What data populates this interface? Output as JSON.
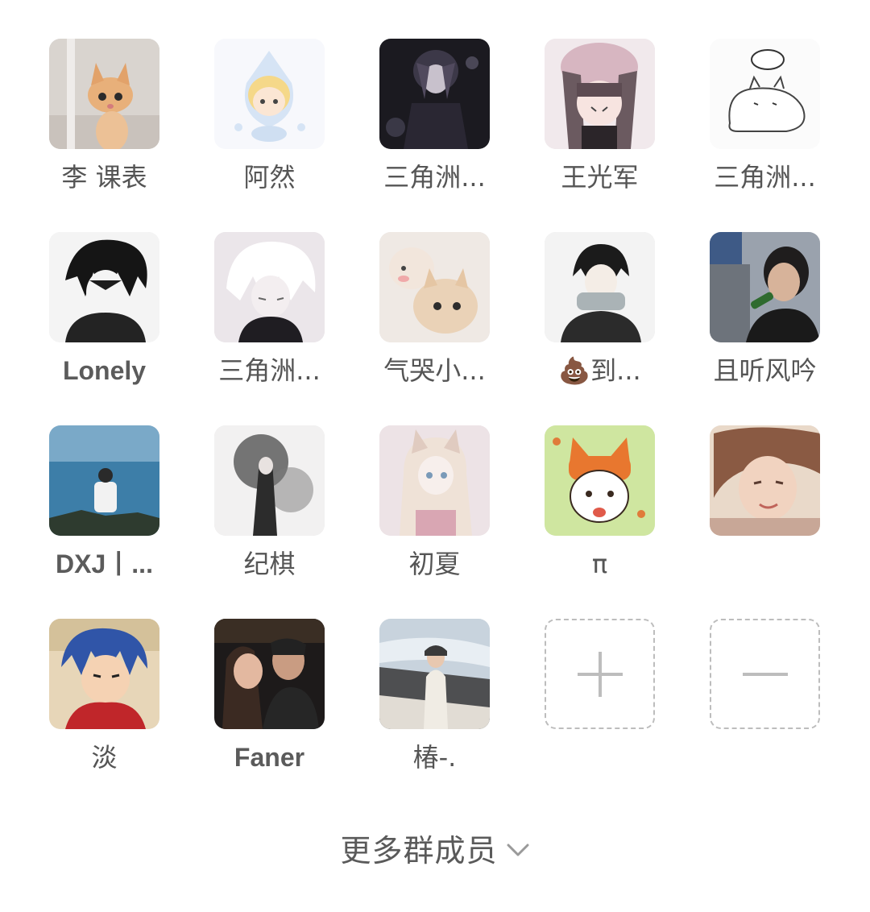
{
  "members": [
    {
      "name": "李 课表",
      "avatar": "orange-kitten-photo"
    },
    {
      "name": "阿然",
      "avatar": "cartoon-character-avatar"
    },
    {
      "name": "三角洲...",
      "avatar": "dark-anime-boy-avatar"
    },
    {
      "name": "王光军",
      "avatar": "anime-girl-cat-ears-avatar"
    },
    {
      "name": "三角洲...",
      "avatar": "sketch-cat-avatar"
    },
    {
      "name": "Lonely",
      "avatar": "black-white-anime-boy-avatar"
    },
    {
      "name": "三角洲...",
      "avatar": "white-hair-anime-avatar"
    },
    {
      "name": "气哭小...",
      "avatar": "two-kittens-photo"
    },
    {
      "name": "💩到...",
      "avatar": "anime-boy-scarf-avatar"
    },
    {
      "name": "且听风吟",
      "avatar": "man-drinking-photo"
    },
    {
      "name": "DXJ丨...",
      "avatar": "person-by-sea-photo"
    },
    {
      "name": "纪棋",
      "avatar": "ink-art-girl-avatar"
    },
    {
      "name": "初夏",
      "avatar": "anime-fox-girl-avatar"
    },
    {
      "name": "π",
      "avatar": "cartoon-fox-dog-avatar"
    },
    {
      "name": "",
      "avatar": "girl-portrait-photo"
    },
    {
      "name": "淡",
      "avatar": "anime-blue-hair-boy-avatar"
    },
    {
      "name": "Faner",
      "avatar": "couple-selfie-photo"
    },
    {
      "name": "椿-.",
      "avatar": "girl-on-beach-photo"
    }
  ],
  "actions": {
    "add": {
      "icon": "plus-icon"
    },
    "remove": {
      "icon": "minus-icon"
    }
  },
  "more_members_label": "更多群成员",
  "more_members_icon": "chevron-down-icon"
}
